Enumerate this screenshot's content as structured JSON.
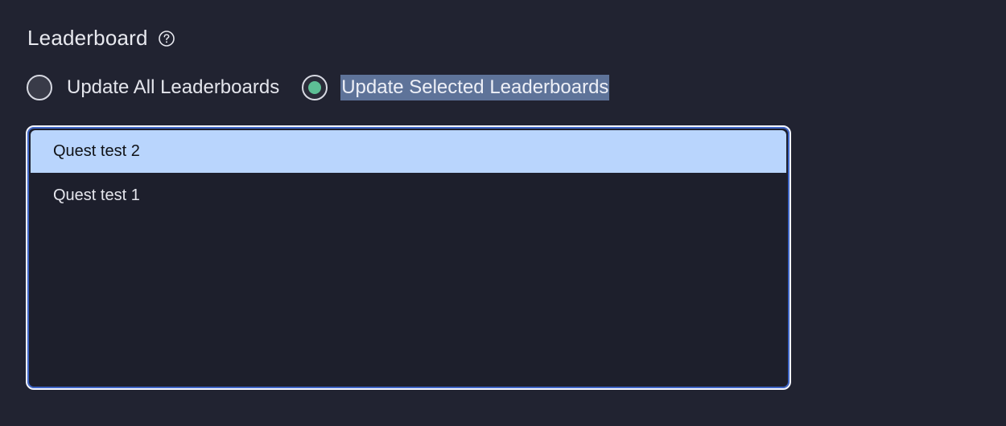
{
  "section": {
    "title": "Leaderboard",
    "help_icon": "question-circle-icon"
  },
  "radio_group": {
    "options": [
      {
        "label": "Update All Leaderboards",
        "selected": false
      },
      {
        "label": "Update Selected Leaderboards",
        "selected": true
      }
    ]
  },
  "listbox": {
    "items": [
      {
        "label": "Quest test 2",
        "selected": true
      },
      {
        "label": "Quest test 1",
        "selected": false
      }
    ]
  },
  "colors": {
    "background": "#212331",
    "radio_selected_dot": "#5dbf95",
    "selection_highlight": "#b9d5fd",
    "focus_ring": "#3f66c7"
  }
}
